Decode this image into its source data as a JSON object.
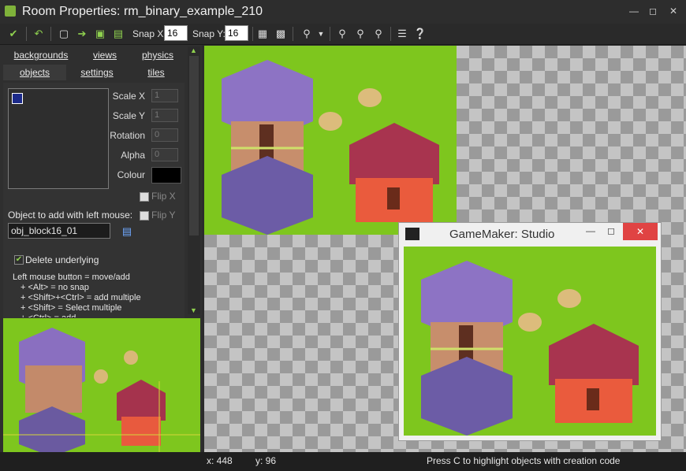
{
  "window": {
    "title": "Room Properties: rm_binary_example_210"
  },
  "toolbar": {
    "snap_x_label": "Snap X:",
    "snap_x_value": "16",
    "snap_y_label": "Snap Y:",
    "snap_y_value": "16"
  },
  "tabs": {
    "backgrounds": "backgrounds",
    "views": "views",
    "physics": "physics",
    "objects": "objects",
    "settings": "settings",
    "tiles": "tiles"
  },
  "props": {
    "scale_x_label": "Scale X",
    "scale_x_value": "1",
    "scale_y_label": "Scale Y",
    "scale_y_value": "1",
    "rotation_label": "Rotation",
    "rotation_value": "0",
    "alpha_label": "Alpha",
    "alpha_value": "0",
    "colour_label": "Colour",
    "flip_x_label": "Flip X",
    "flip_y_label": "Flip Y",
    "object_add_label": "Object to add with left mouse:",
    "object_value": "obj_block16_01",
    "delete_underlying_label": "Delete underlying",
    "help_lines": [
      "Left mouse button = move/add",
      "+ <Alt> = no snap",
      "+ <Shift>+<Ctrl> = add multiple",
      "+ <Shift> = Select multiple",
      "+ <Ctrl> = add"
    ]
  },
  "status": {
    "x": "x: 448",
    "y": "y: 96",
    "message": "Press C to highlight objects with creation code"
  },
  "popup": {
    "title": "GameMaker: Studio"
  },
  "colors": {
    "grass": "#7ec61e",
    "accent": "#7fb23a"
  }
}
